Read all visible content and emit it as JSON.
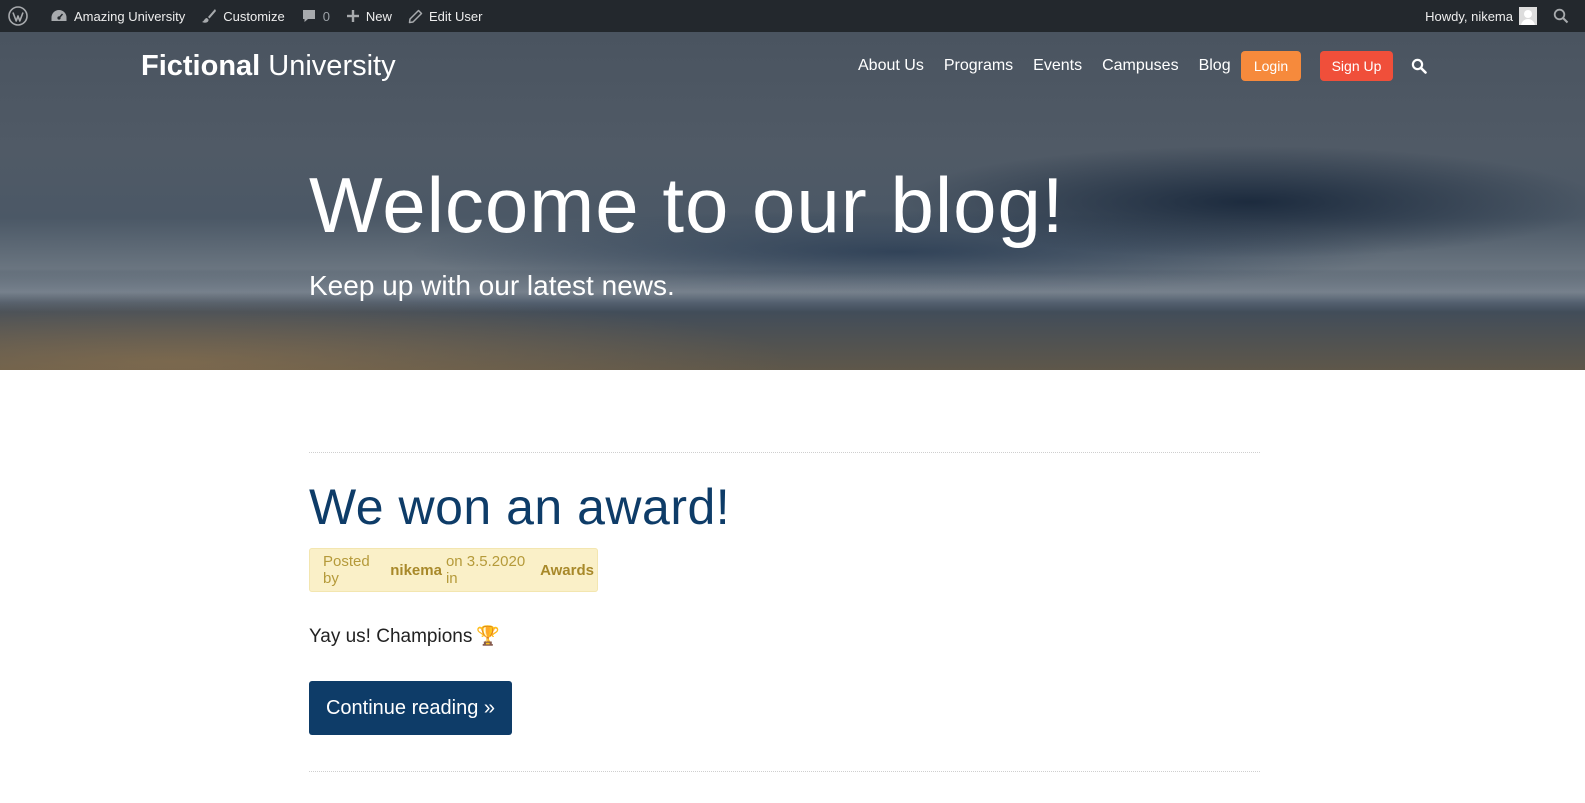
{
  "admin_bar": {
    "site_name": "Amazing University",
    "customize": "Customize",
    "comments_count": "0",
    "new": "New",
    "edit_user": "Edit User",
    "howdy": "Howdy, nikema"
  },
  "header": {
    "logo_bold": "Fictional",
    "logo_light": "University",
    "nav": {
      "about": "About Us",
      "programs": "Programs",
      "events": "Events",
      "campuses": "Campuses",
      "blog": "Blog"
    },
    "login": "Login",
    "signup": "Sign Up"
  },
  "hero": {
    "title": "Welcome to our blog!",
    "subtitle": "Keep up with our latest news."
  },
  "post": {
    "title": "We won an award!",
    "meta_posted_by": "Posted by",
    "meta_author": "nikema",
    "meta_on": "on 3.5.2020 in",
    "meta_category": "Awards",
    "excerpt": "Yay us! Champions",
    "excerpt_emoji": "🏆",
    "continue": "Continue reading »"
  },
  "colors": {
    "admin_bar": "#23282d",
    "login": "#f68a3c",
    "signup": "#f04f3a",
    "primary_blue": "#0e3c68",
    "meta_bg": "#faf0c8",
    "meta_text": "#b59a3a"
  },
  "icons": {
    "wordpress": "wordpress-icon",
    "dashboard": "dashboard-icon",
    "customize": "paintbrush-icon",
    "comments": "comment-icon",
    "new": "plus-icon",
    "edit": "pencil-icon",
    "avatar": "user-avatar",
    "admin_search": "search-icon",
    "nav_search": "search-icon"
  }
}
